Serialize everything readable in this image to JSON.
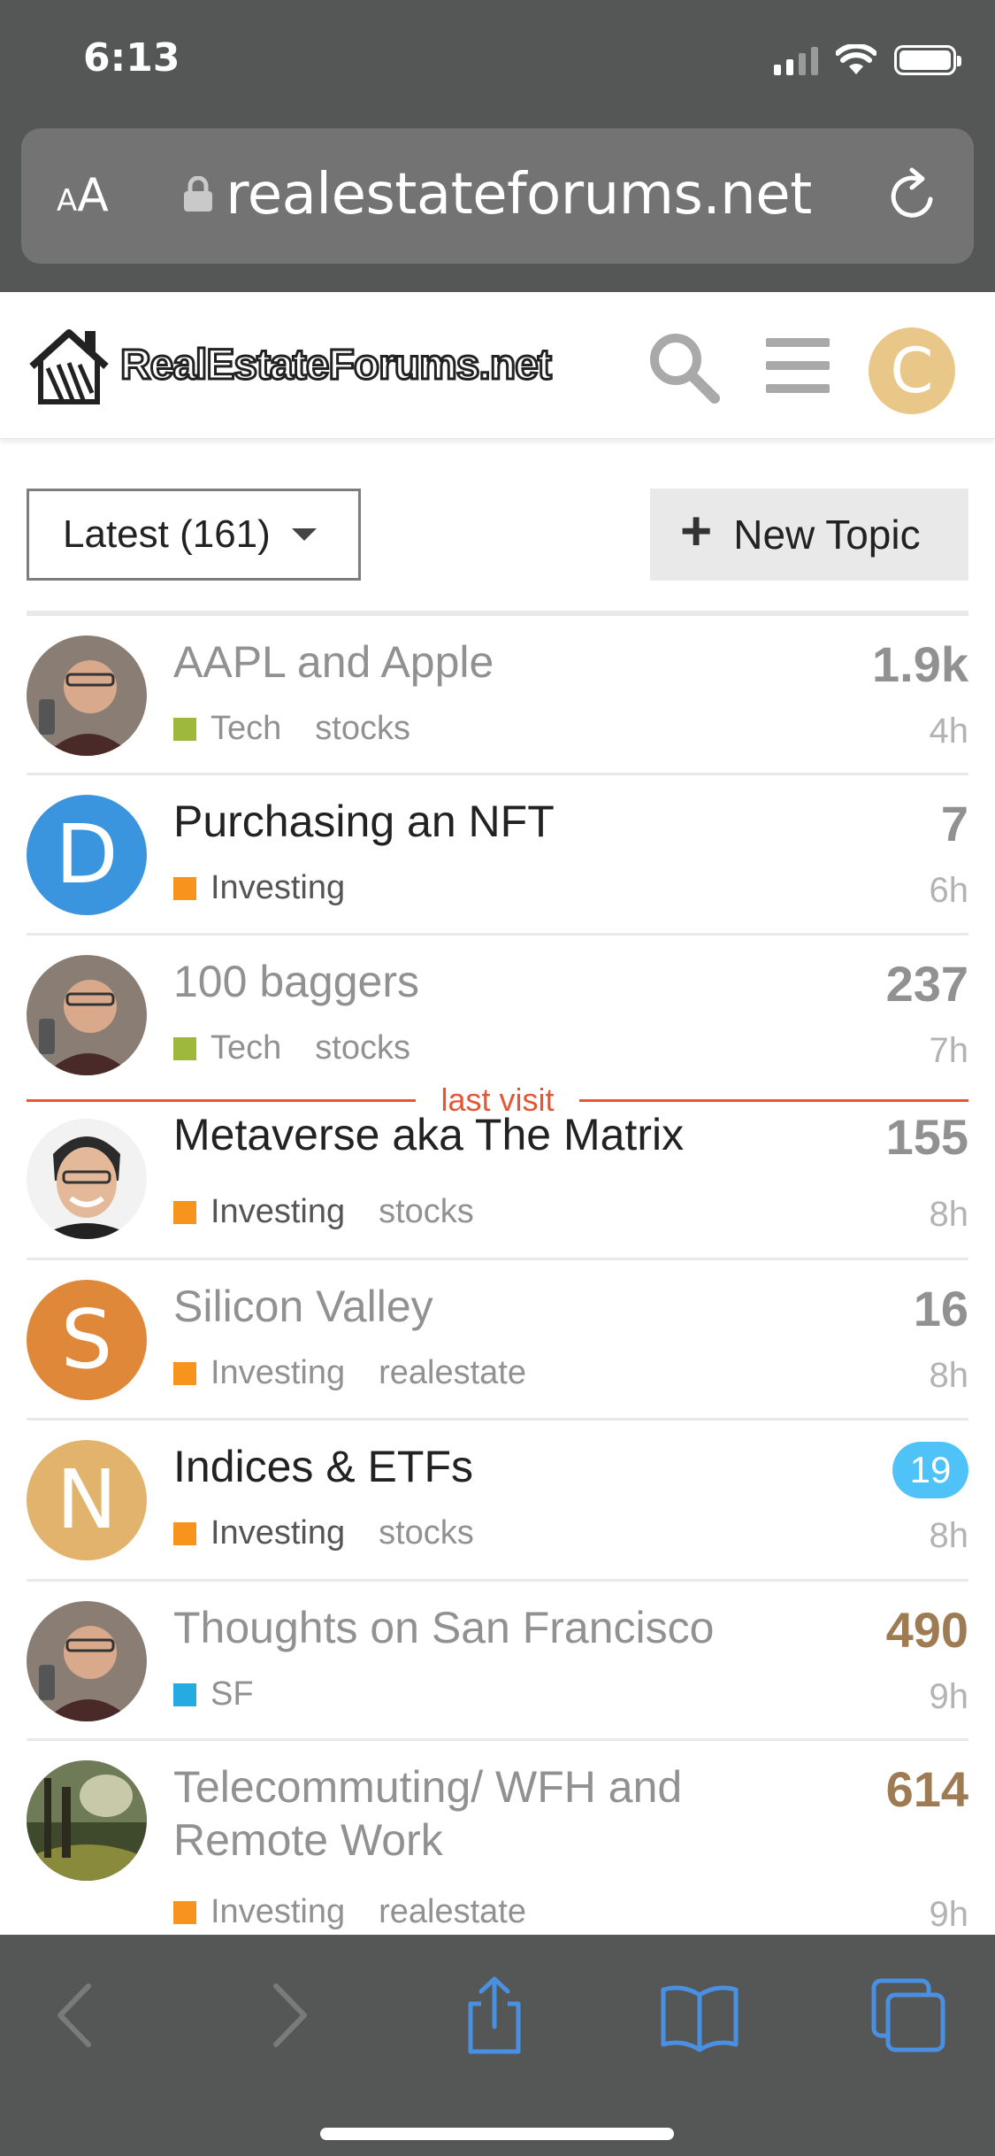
{
  "status_bar": {
    "time": "6:13",
    "icons": [
      "cellular-signal-icon",
      "wifi-icon",
      "battery-icon"
    ]
  },
  "browser": {
    "text_size_label_small": "A",
    "text_size_label_big": "A",
    "url": "realestateforums.net",
    "icons": [
      "lock-icon",
      "reload-icon"
    ],
    "toolbar": [
      "back-icon",
      "forward-icon",
      "share-icon",
      "bookmarks-icon",
      "tabs-icon"
    ]
  },
  "site": {
    "logo_text": "RealEstateForums.net",
    "user_avatar_letter": "C",
    "colors": {
      "avatar_bg": "#e9c788",
      "last_visit": "#e45735",
      "badge": "#4fc3f7"
    }
  },
  "controls": {
    "filter_label": "Latest (161)",
    "new_topic_label": "New Topic"
  },
  "last_visit_label": "last visit",
  "topics": [
    {
      "title": "AAPL and Apple",
      "category": "Tech",
      "category_color": "#9eb83b",
      "tags": [
        "stocks"
      ],
      "count": "1.9k",
      "age": "4h",
      "read": true,
      "avatar": "photo-man-glasses"
    },
    {
      "title": "Purchasing an NFT",
      "category": "Investing",
      "category_color": "#f7941d",
      "tags": [],
      "count": "7",
      "age": "6h",
      "read": false,
      "avatar_letter": "D",
      "avatar_color": "#3a95de"
    },
    {
      "title": "100 baggers",
      "category": "Tech",
      "category_color": "#9eb83b",
      "tags": [
        "stocks"
      ],
      "count": "237",
      "age": "7h",
      "read": true,
      "avatar": "photo-man-glasses"
    },
    {
      "title": "Metaverse aka The Matrix",
      "category": "Investing",
      "category_color": "#f7941d",
      "tags": [
        "stocks"
      ],
      "count": "155",
      "age": "8h",
      "read": false,
      "avatar": "photo-smiling-man"
    },
    {
      "title": "Silicon Valley",
      "category": "Investing",
      "category_color": "#f7941d",
      "tags": [
        "realestate"
      ],
      "count": "16",
      "age": "8h",
      "read": true,
      "avatar_letter": "S",
      "avatar_color": "#e0883a"
    },
    {
      "title": "Indices & ETFs",
      "category": "Investing",
      "category_color": "#f7941d",
      "tags": [
        "stocks"
      ],
      "new_badge": "19",
      "age": "8h",
      "read": false,
      "avatar_letter": "N",
      "avatar_color": "#e1b36c"
    },
    {
      "title": "Thoughts on San Francisco",
      "category": "SF",
      "category_color": "#25aae2",
      "tags": [],
      "count": "490",
      "age": "9h",
      "read": true,
      "avatar": "photo-man-glasses"
    },
    {
      "title_line1": "Telecommuting/ WFH and",
      "title_line2": "Remote Work",
      "category": "Investing",
      "category_color": "#f7941d",
      "tags": [
        "realestate"
      ],
      "count": "614",
      "age": "9h",
      "read": true,
      "avatar": "photo-forest"
    }
  ]
}
